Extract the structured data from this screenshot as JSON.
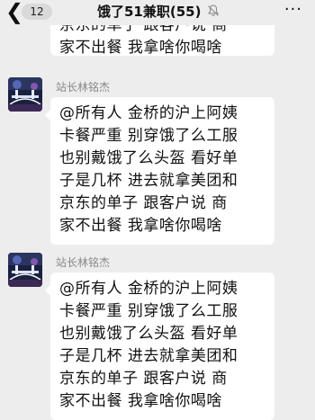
{
  "header": {
    "back_icon": "chevron-left-icon",
    "unread_badge": "12",
    "title": "饿了51兼职(55)",
    "mute_icon": "bell-off-icon",
    "more": "···"
  },
  "messages": [
    {
      "sender": "",
      "lines": [
        "京东的单子    跟客户说 商",
        "家不出餐  我拿啥你喝啥"
      ]
    },
    {
      "sender": "站长林铭杰",
      "lines": [
        "@所有人  金桥的沪上阿姨",
        "卡餐严重    别穿饿了么工服",
        "也别戴饿了么头盔    看好单",
        "子是几杯    进去就拿美团和",
        "京东的单子    跟客户说  商",
        "家不出餐  我拿啥你喝啥"
      ]
    },
    {
      "sender": "站长林铭杰",
      "lines": [
        "@所有人  金桥的沪上阿姨",
        "卡餐严重    别穿饿了么工服",
        "也别戴饿了么头盔    看好单",
        "子是几杯    进去就拿美团和",
        "京东的单子    跟客户说  商",
        "家不出餐  我拿啥你喝啥"
      ]
    }
  ]
}
